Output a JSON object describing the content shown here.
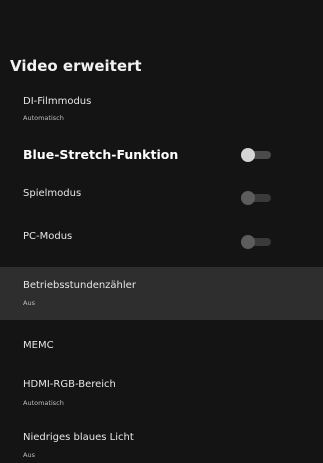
{
  "menu": {
    "title": "Video erweitert",
    "items": [
      {
        "label": "DI-Filmmodus",
        "value": "Automatisch"
      },
      {
        "label": "Blue-Stretch-Funktion",
        "toggle_state": "off"
      },
      {
        "label": "Spielmodus",
        "toggle_state": "off"
      },
      {
        "label": "PC-Modus",
        "toggle_state": "off"
      },
      {
        "label": "Betriebsstundenzähler",
        "value": "Aus"
      },
      {
        "label": "MEMC"
      },
      {
        "label": "HDMI-RGB-Bereich",
        "value": "Automatisch"
      },
      {
        "label": "Niedriges blaues Licht",
        "value": "Aus"
      }
    ]
  }
}
